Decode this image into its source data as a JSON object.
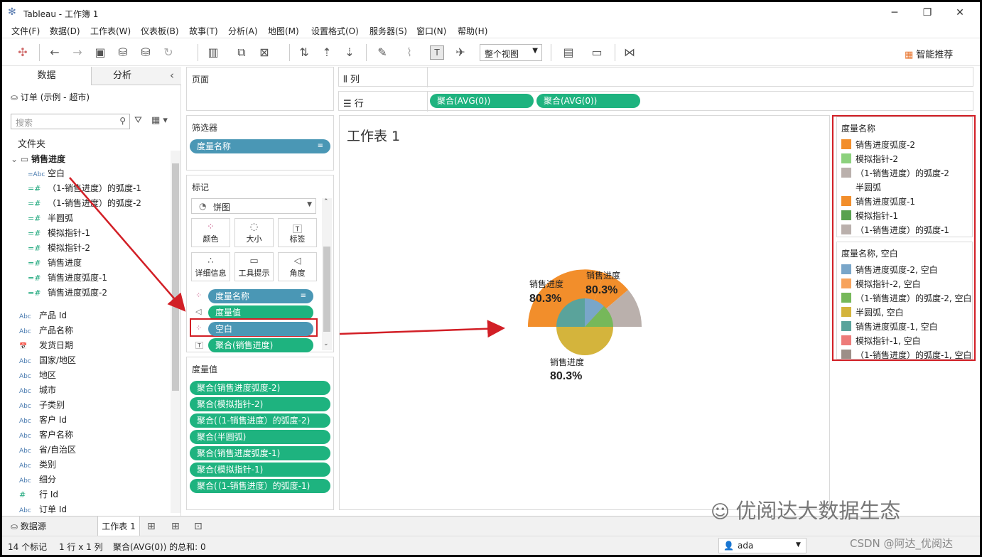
{
  "window": {
    "title": "Tableau - 工作簿 1",
    "minimize": "─",
    "maximize": "❐",
    "close": "✕"
  },
  "menu": [
    "文件(F)",
    "数据(D)",
    "工作表(W)",
    "仪表板(B)",
    "故事(T)",
    "分析(A)",
    "地图(M)",
    "设置格式(O)",
    "服务器(S)",
    "窗口(N)",
    "帮助(H)"
  ],
  "toolbar": {
    "fit": "整个视图",
    "smart": "智能推荐"
  },
  "datapane": {
    "tab_data": "数据",
    "tab_analysis": "分析",
    "collapse": "‹",
    "datasource": "订单 (示例 - 超市)",
    "search_placeholder": "搜索",
    "folder_label": "文件夹",
    "group": "销售进度",
    "fields_in_group": [
      {
        "type": "=Abc",
        "name": "空白"
      },
      {
        "type": "=#",
        "name": "（1-销售进度）的弧度-1"
      },
      {
        "type": "=#",
        "name": "（1-销售进度）的弧度-2"
      },
      {
        "type": "=#",
        "name": "半圆弧"
      },
      {
        "type": "=#",
        "name": "模拟指针-1"
      },
      {
        "type": "=#",
        "name": "模拟指针-2"
      },
      {
        "type": "=#",
        "name": "销售进度"
      },
      {
        "type": "=#",
        "name": "销售进度弧度-1"
      },
      {
        "type": "=#",
        "name": "销售进度弧度-2"
      }
    ],
    "fields": [
      {
        "type": "Abc",
        "name": "产品 Id"
      },
      {
        "type": "Abc",
        "name": "产品名称"
      },
      {
        "type": "📅",
        "name": "发货日期"
      },
      {
        "type": "Abc",
        "name": "国家/地区"
      },
      {
        "type": "Abc",
        "name": "地区"
      },
      {
        "type": "Abc",
        "name": "城市"
      },
      {
        "type": "Abc",
        "name": "子类别"
      },
      {
        "type": "Abc",
        "name": "客户 Id"
      },
      {
        "type": "Abc",
        "name": "客户名称"
      },
      {
        "type": "Abc",
        "name": "省/自治区"
      },
      {
        "type": "Abc",
        "name": "类别"
      },
      {
        "type": "Abc",
        "name": "细分"
      },
      {
        "type": "#",
        "name": "行 Id"
      },
      {
        "type": "Abc",
        "name": "订单 Id"
      }
    ]
  },
  "pages": {
    "title": "页面"
  },
  "filters": {
    "title": "筛选器",
    "pill": "度量名称"
  },
  "marks": {
    "title": "标记",
    "type": "饼图",
    "buttons": {
      "color": "颜色",
      "size": "大小",
      "label": "标签",
      "detail": "详细信息",
      "tooltip": "工具提示",
      "angle": "角度"
    },
    "pills": [
      "度量名称",
      "度量值",
      "空白",
      "聚合(销售进度)"
    ]
  },
  "measure_values": {
    "title": "度量值",
    "pills": [
      "聚合(销售进度弧度-2)",
      "聚合(模拟指针-2)",
      "聚合(（1-销售进度）的弧度-2)",
      "聚合(半圆弧)",
      "聚合(销售进度弧度-1)",
      "聚合(模拟指针-1)",
      "聚合(（1-销售进度）的弧度-1)"
    ]
  },
  "columns": {
    "label": "列"
  },
  "rows": {
    "label": "行",
    "pills": [
      "聚合(AVG(0))",
      "聚合(AVG(0))"
    ]
  },
  "view": {
    "sheet_title": "工作表 1",
    "labels": [
      {
        "name": "销售进度",
        "value": "80.3%"
      },
      {
        "name": "销售进度",
        "value": "80.3%"
      },
      {
        "name": "销售进度",
        "value": "80.3%"
      }
    ]
  },
  "colors": {
    "orange": "#f28e2b",
    "light_green": "#8cd17d",
    "taupe": "#bab0ac",
    "green": "#59a14f",
    "steel_blue": "#79a6c9",
    "light_orange": "#f7a35c",
    "green2": "#76b85a",
    "mustard": "#d4b43c",
    "teal": "#5aa39b",
    "pink": "#ed7b79",
    "gray": "#9c8f88",
    "red": "#d21f26",
    "pill_green": "#1eb37f",
    "pill_blue": "#4a97b5"
  },
  "legend1": {
    "title": "度量名称",
    "items": [
      {
        "name": "销售进度弧度-2",
        "color": "#f28e2b"
      },
      {
        "name": "模拟指针-2",
        "color": "#8cd17d"
      },
      {
        "name": "（1-销售进度）的弧度-2",
        "color": "#bab0ac"
      },
      {
        "name": "半圆弧",
        "color": ""
      },
      {
        "name": "销售进度弧度-1",
        "color": "#f28e2b"
      },
      {
        "name": "模拟指针-1",
        "color": "#59a14f"
      },
      {
        "name": "（1-销售进度）的弧度-1",
        "color": "#bab0ac"
      }
    ]
  },
  "legend2": {
    "title": "度量名称, 空白",
    "items": [
      {
        "name": "销售进度弧度-2, 空白",
        "color": "#79a6c9"
      },
      {
        "name": "模拟指针-2, 空白",
        "color": "#f7a35c"
      },
      {
        "name": "（1-销售进度）的弧度-2, 空白",
        "color": "#76b85a"
      },
      {
        "name": "半圆弧, 空白",
        "color": "#d4b43c"
      },
      {
        "name": "销售进度弧度-1, 空白",
        "color": "#5aa39b"
      },
      {
        "name": "模拟指针-1, 空白",
        "color": "#ed7b79"
      },
      {
        "name": "（1-销售进度）的弧度-1, 空白",
        "color": "#9c8f88"
      }
    ]
  },
  "sheettabs": {
    "datasource": "数据源",
    "sheet": "工作表 1"
  },
  "status": {
    "marks": "14 个标记",
    "dims": "1 行 x 1 列",
    "sum": "聚合(AVG(0)) 的总和: 0",
    "user": "ada"
  },
  "watermark": "优阅达大数据生态",
  "watermark2": "CSDN @阿达_优阅达"
}
